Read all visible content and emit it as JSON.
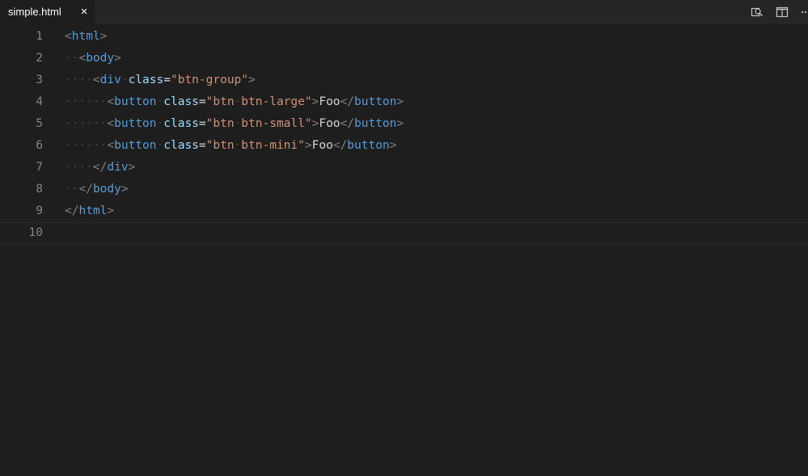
{
  "tab": {
    "title": "simple.html",
    "close_glyph": "×"
  },
  "actions": [
    {
      "icon": "open-preview-icon"
    },
    {
      "icon": "split-editor-icon"
    },
    {
      "icon": "more-actions-icon"
    }
  ],
  "colors": {
    "tag": "#569cd6",
    "attribute": "#9cdcfe",
    "string": "#ce9178",
    "text": "#d4d4d4",
    "bracket": "#808080",
    "whitespace_marker": "#404040",
    "line_number": "#858585",
    "background": "#1e1e1e"
  },
  "editor": {
    "current_line": 10,
    "lines": [
      {
        "n": "1",
        "tokens": [
          [
            "br",
            "<"
          ],
          [
            "tg",
            "html"
          ],
          [
            "br",
            ">"
          ]
        ]
      },
      {
        "n": "2",
        "tokens": [
          [
            "ws",
            "··"
          ],
          [
            "br",
            "<"
          ],
          [
            "tg",
            "body"
          ],
          [
            "br",
            ">"
          ]
        ]
      },
      {
        "n": "3",
        "tokens": [
          [
            "ws",
            "····"
          ],
          [
            "br",
            "<"
          ],
          [
            "tg",
            "div"
          ],
          [
            "ws",
            "·"
          ],
          [
            "at",
            "class"
          ],
          [
            "eq",
            "="
          ],
          [
            "st",
            "\"btn-group\""
          ],
          [
            "br",
            ">"
          ]
        ]
      },
      {
        "n": "4",
        "tokens": [
          [
            "ws",
            "······"
          ],
          [
            "br",
            "<"
          ],
          [
            "tg",
            "button"
          ],
          [
            "ws",
            "·"
          ],
          [
            "at",
            "class"
          ],
          [
            "eq",
            "="
          ],
          [
            "st",
            "\"btn"
          ],
          [
            "ws",
            "·"
          ],
          [
            "st",
            "btn-large\""
          ],
          [
            "br",
            ">"
          ],
          [
            "tx",
            "Foo"
          ],
          [
            "br",
            "</"
          ],
          [
            "tg",
            "button"
          ],
          [
            "br",
            ">"
          ]
        ]
      },
      {
        "n": "5",
        "tokens": [
          [
            "ws",
            "······"
          ],
          [
            "br",
            "<"
          ],
          [
            "tg",
            "button"
          ],
          [
            "ws",
            "·"
          ],
          [
            "at",
            "class"
          ],
          [
            "eq",
            "="
          ],
          [
            "st",
            "\"btn"
          ],
          [
            "ws",
            "·"
          ],
          [
            "st",
            "btn-small\""
          ],
          [
            "br",
            ">"
          ],
          [
            "tx",
            "Foo"
          ],
          [
            "br",
            "</"
          ],
          [
            "tg",
            "button"
          ],
          [
            "br",
            ">"
          ]
        ]
      },
      {
        "n": "6",
        "tokens": [
          [
            "ws",
            "······"
          ],
          [
            "br",
            "<"
          ],
          [
            "tg",
            "button"
          ],
          [
            "ws",
            "·"
          ],
          [
            "at",
            "class"
          ],
          [
            "eq",
            "="
          ],
          [
            "st",
            "\"btn"
          ],
          [
            "ws",
            "·"
          ],
          [
            "st",
            "btn-mini\""
          ],
          [
            "br",
            ">"
          ],
          [
            "tx",
            "Foo"
          ],
          [
            "br",
            "</"
          ],
          [
            "tg",
            "button"
          ],
          [
            "br",
            ">"
          ]
        ]
      },
      {
        "n": "7",
        "tokens": [
          [
            "ws",
            "····"
          ],
          [
            "br",
            "</"
          ],
          [
            "tg",
            "div"
          ],
          [
            "br",
            ">"
          ]
        ]
      },
      {
        "n": "8",
        "tokens": [
          [
            "ws",
            "··"
          ],
          [
            "br",
            "</"
          ],
          [
            "tg",
            "body"
          ],
          [
            "br",
            ">"
          ]
        ]
      },
      {
        "n": "9",
        "tokens": [
          [
            "br",
            "</"
          ],
          [
            "tg",
            "html"
          ],
          [
            "br",
            ">"
          ]
        ]
      },
      {
        "n": "10",
        "tokens": []
      }
    ]
  }
}
